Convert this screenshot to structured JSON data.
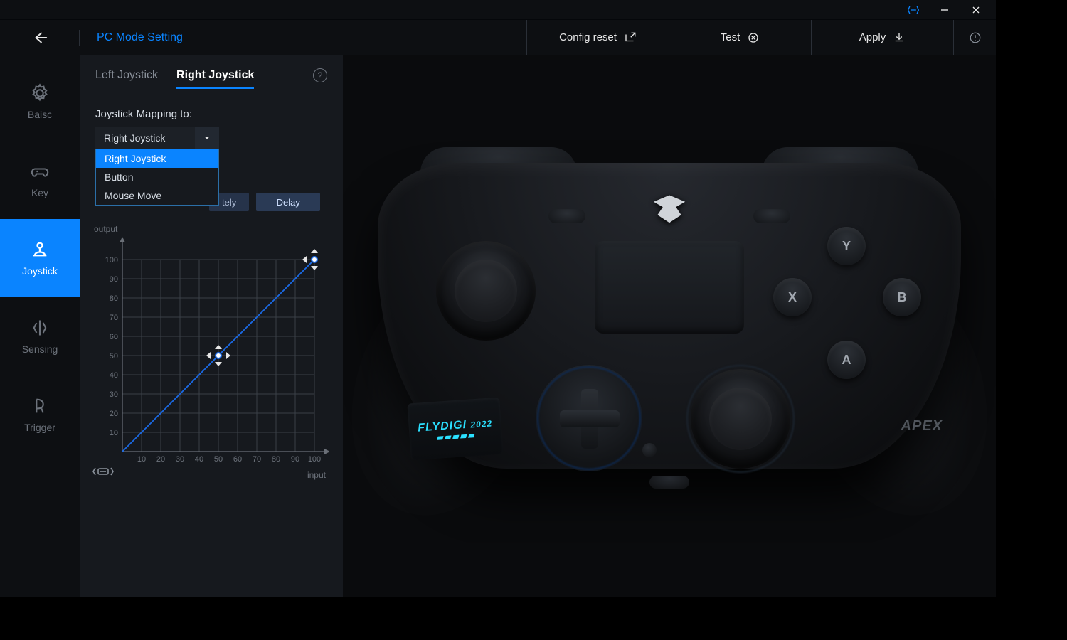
{
  "titlebar": {
    "sync_color": "#0a84ff"
  },
  "header": {
    "mode_label": "PC Mode Setting",
    "config_reset": "Config reset",
    "test": "Test",
    "apply": "Apply"
  },
  "sidebar": {
    "items": [
      {
        "id": "basic",
        "label": "Baisc"
      },
      {
        "id": "key",
        "label": "Key"
      },
      {
        "id": "joystick",
        "label": "Joystick"
      },
      {
        "id": "sensing",
        "label": "Sensing"
      },
      {
        "id": "trigger",
        "label": "Trigger"
      }
    ],
    "active": "joystick"
  },
  "tabs": {
    "left": "Left Joystick",
    "right": "Right Joystick",
    "active": "right"
  },
  "mapping": {
    "label": "Joystick Mapping to:",
    "selected": "Right Joystick",
    "options": [
      "Right Joystick",
      "Button",
      "Mouse Move"
    ],
    "open": true
  },
  "curve_hint_partial": "tely",
  "curve_buttons": {
    "delay": "Delay"
  },
  "chart_data": {
    "type": "line",
    "xlabel": "input",
    "ylabel": "output",
    "xlim": [
      0,
      100
    ],
    "ylim": [
      0,
      100
    ],
    "xticks": [
      10,
      20,
      30,
      40,
      50,
      60,
      70,
      80,
      90,
      100
    ],
    "yticks": [
      10,
      20,
      30,
      40,
      50,
      60,
      70,
      80,
      90,
      100
    ],
    "series": [
      {
        "name": "curve",
        "x": [
          0,
          50,
          100
        ],
        "y": [
          0,
          50,
          100
        ]
      }
    ],
    "handles": [
      {
        "x": 50,
        "y": 50
      },
      {
        "x": 100,
        "y": 100
      }
    ]
  },
  "controller": {
    "brand": "FLYDIGI",
    "year": "2022",
    "model": "APEX",
    "face_buttons": {
      "y": "Y",
      "b": "B",
      "a": "A",
      "x": "X"
    }
  }
}
